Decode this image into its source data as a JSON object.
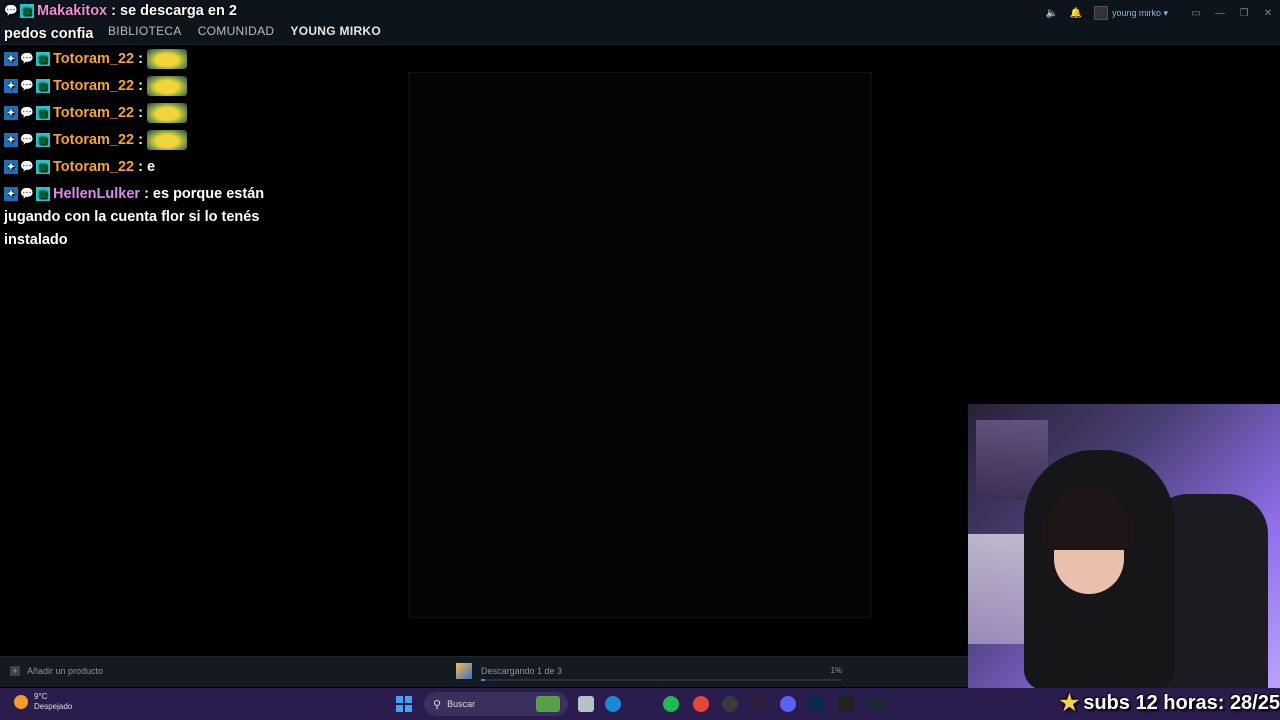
{
  "steam": {
    "nav": [
      "BIBLIOTECA",
      "COMUNIDAD",
      "YOUNG MIRKO"
    ],
    "username": "young mirko",
    "add_product": "Añadir un producto",
    "download_status": "Descargando 1 de 3",
    "download_percent": "1%",
    "download_progress": 0.01
  },
  "chat": {
    "messages": [
      {
        "user": "Makakitox",
        "text": ": se descarga en 2 pedos confia"
      },
      {
        "user": "Totoram_22",
        "text": ":"
      },
      {
        "user": "Totoram_22",
        "text": ":"
      },
      {
        "user": "Totoram_22",
        "text": ":"
      },
      {
        "user": "Totoram_22",
        "text": ":"
      },
      {
        "user": "Totoram_22",
        "text": ": e"
      },
      {
        "user": "HellenLulker",
        "text": ": es porque están jugando con la cuenta flor si lo tenés instalado"
      }
    ]
  },
  "taskbar": {
    "temp": "9°C",
    "weather": "Despejado",
    "search_placeholder": "Buscar"
  },
  "stream_overlay": {
    "text": "subs 12 horas: 28/25"
  },
  "colors": {
    "steam_bg": "#0e141c",
    "taskbar_bg": "#2a1d4e",
    "accent_blue": "#3d8ae0"
  }
}
